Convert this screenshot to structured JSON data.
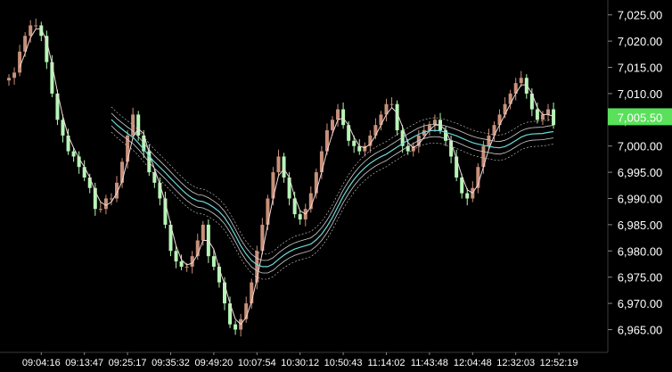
{
  "chart_data": {
    "type": "candlestick",
    "y_axis": {
      "range": [
        6961,
        7027.5
      ],
      "ticks": [
        "7,025.00",
        "7,020.00",
        "7,015.00",
        "7,010.00",
        "7,005.00",
        "7,000.00",
        "6,995.00",
        "6,990.00",
        "6,985.00",
        "6,980.00",
        "6,975.00",
        "6,970.00",
        "6,965.00"
      ],
      "tick_values": [
        7025,
        7020,
        7015,
        7010,
        7005,
        7000,
        6995,
        6990,
        6985,
        6980,
        6975,
        6970,
        6965
      ]
    },
    "x_axis": {
      "ticks": [
        "09:04:16",
        "09:13:47",
        "09:25:17",
        "09:35:32",
        "09:49:20",
        "10:07:54",
        "10:30:12",
        "10:50:43",
        "11:14:02",
        "11:43:48",
        "12:04:48",
        "12:32:03",
        "12:52:19"
      ],
      "tick_bar_index": [
        6,
        14,
        22,
        30,
        38,
        46,
        54,
        62,
        70,
        78,
        86,
        94,
        102
      ]
    },
    "last_price": {
      "value": 7005.5,
      "label": "7,005.50"
    },
    "grid": false,
    "colors": {
      "background": "#000000",
      "up": "#c8907a",
      "down": "#b6f5b6",
      "fast_ma": "#f0d8d8",
      "middle_band": "#6dd8d8",
      "outer_bands": "#cfcfcf",
      "price_label_bg": "#5ae05a",
      "axis_text": "#ffffff"
    },
    "closes": [
      7013,
      7014,
      7018,
      7021,
      7023,
      7023,
      7021,
      7016,
      7010,
      7005,
      7002,
      6999,
      6998,
      6996,
      6994,
      6992,
      6988,
      6988,
      6990,
      6990,
      6993,
      6997,
      7002,
      7006,
      7002,
      6999,
      6995,
      6993,
      6990,
      6985,
      6980,
      6978,
      6977,
      6977,
      6979,
      6982,
      6985,
      6979,
      6977,
      6974,
      6970,
      6966,
      6965,
      6967,
      6970,
      6974,
      6980,
      6985,
      6990,
      6995,
      6998,
      6994,
      6990,
      6987,
      6986,
      6988,
      6991,
      6995,
      6999,
      7003,
      7005,
      7007,
      7004,
      7001,
      7000,
      6999,
      7000,
      7002,
      7004,
      7006,
      7008,
      7008,
      7003,
      7000,
      6999,
      7000,
      7002,
      7003,
      7004,
      7005,
      7003,
      7001,
      6998,
      6994,
      6991,
      6990,
      6992,
      6996,
      7000,
      7002,
      7004,
      7006,
      7008,
      7010,
      7012,
      7013,
      7010,
      7007,
      7005,
      7006,
      7007,
      7004
    ]
  }
}
